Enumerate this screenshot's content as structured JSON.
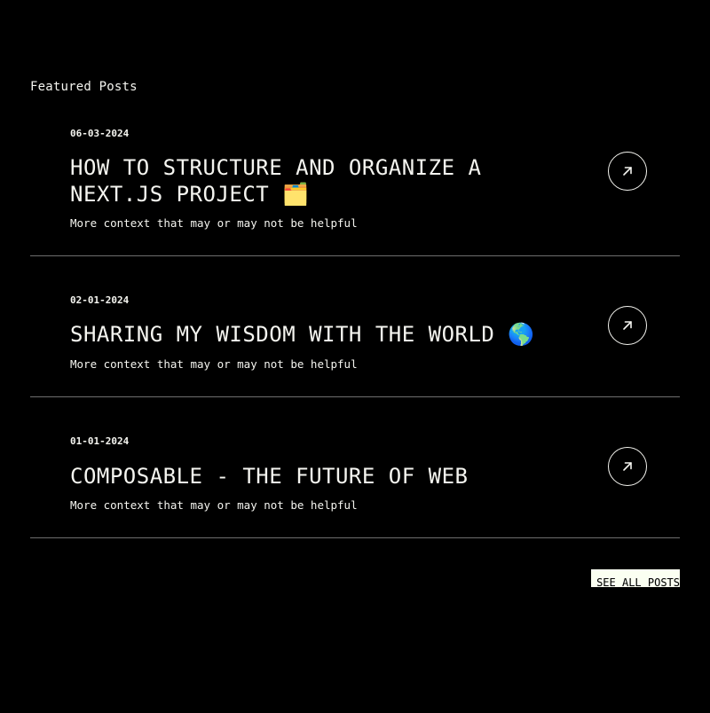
{
  "section": {
    "title": "Featured Posts"
  },
  "posts": [
    {
      "date": "06-03-2024",
      "title": "HOW TO STRUCTURE AND ORGANIZE A NEXT.JS PROJECT 🗂️",
      "description": "More context that may or may not be helpful",
      "link_icon": "arrow-up-right-icon"
    },
    {
      "date": "02-01-2024",
      "title": "SHARING MY WISDOM WITH THE WORLD 🌎",
      "description": "More context that may or may not be helpful",
      "link_icon": "arrow-up-right-icon"
    },
    {
      "date": "01-01-2024",
      "title": "COMPOSABLE - THE FUTURE OF WEB",
      "description": "More context that may or may not be helpful",
      "link_icon": "arrow-up-right-icon"
    }
  ],
  "see_all": {
    "label": "SEE ALL POSTS"
  },
  "colors": {
    "background": "#000000",
    "text": "#f5f5f0",
    "divider": "#6e6e6e",
    "button_fill": "#fbfff2"
  }
}
